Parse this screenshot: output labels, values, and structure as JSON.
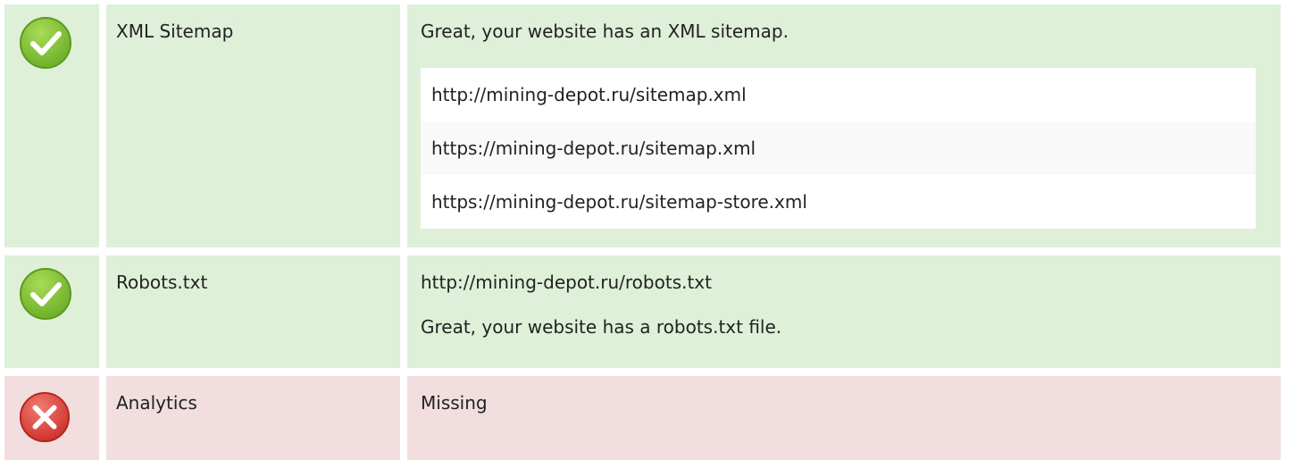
{
  "colors": {
    "ok_background": "#dff0d8",
    "error_background": "#f2dede",
    "ok_icon": "#7fbf31",
    "error_icon": "#e0433d"
  },
  "rows": {
    "sitemap": {
      "status": "pass",
      "status_icon": "checkmark-circle-icon",
      "name": "XML Sitemap",
      "message": "Great, your website has an XML sitemap.",
      "urls": [
        "http://mining-depot.ru/sitemap.xml",
        "https://mining-depot.ru/sitemap.xml",
        "https://mining-depot.ru/sitemap-store.xml"
      ]
    },
    "robots": {
      "status": "pass",
      "status_icon": "checkmark-circle-icon",
      "name": "Robots.txt",
      "url": "http://mining-depot.ru/robots.txt",
      "message": "Great, your website has a robots.txt file."
    },
    "analytics": {
      "status": "fail",
      "status_icon": "cross-circle-icon",
      "name": "Analytics",
      "message": "Missing"
    }
  }
}
